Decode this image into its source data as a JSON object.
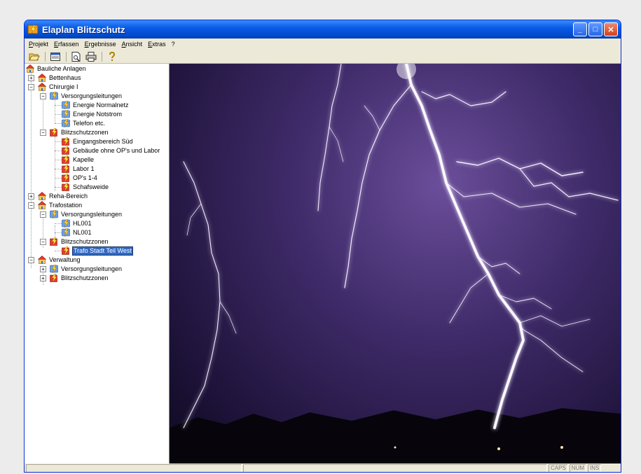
{
  "window": {
    "title": "Elaplan Blitzschutz"
  },
  "menu": [
    {
      "label": "Projekt"
    },
    {
      "label": "Erfassen"
    },
    {
      "label": "Ergebnisse"
    },
    {
      "label": "Ansicht"
    },
    {
      "label": "Extras"
    },
    {
      "label": "?"
    }
  ],
  "toolbar": [
    {
      "icon": "open-folder-icon"
    },
    {
      "icon": "window-icon"
    },
    {
      "icon": "print-preview-icon"
    },
    {
      "icon": "print-icon"
    },
    {
      "icon": "help-icon"
    }
  ],
  "tree": {
    "root": "Bauliche Anlagen",
    "bettenhaus": "Bettenhaus",
    "chirurgie": "Chirurgie I",
    "c_versorg": "Versorgungsleitungen",
    "c_v1": "Energie Normalnetz",
    "c_v2": "Energie Notstrom",
    "c_v3": "Telefon etc.",
    "c_blitz": "Blitzschutzzonen",
    "c_b1": "Eingangsbereich Süd",
    "c_b2": "Gebäude ohne OP's und Labor",
    "c_b3": "Kapelle",
    "c_b4": "Labor 1",
    "c_b5": "OP's 1-4",
    "c_b6": "Schafsweide",
    "reha": "Reha-Bereich",
    "trafo": "Trafostation",
    "t_versorg": "Versorgungsleitungen",
    "t_v1": "HL001",
    "t_v2": "NL001",
    "t_blitz": "Blitzschutzzonen",
    "t_b1": "Trafo Stadt Teil West",
    "verwaltung": "Verwaltung",
    "v_versorg": "Versorgungsleitungen",
    "v_blitz": "Blitzschutzzonen"
  },
  "status": {
    "caps": "CAPS",
    "num": "NUM",
    "ins": "INS"
  },
  "colors": {
    "titlebar": "#0a5ce5",
    "selection": "#316ac5",
    "sky": "#3e2a68"
  }
}
